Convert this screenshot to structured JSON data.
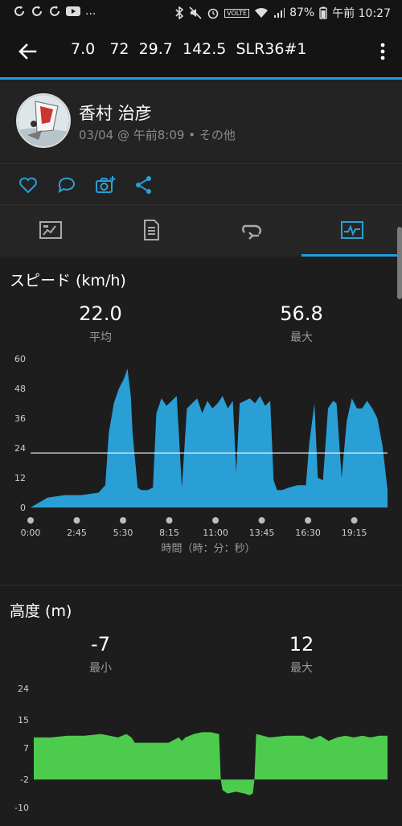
{
  "status_bar": {
    "notification_icons": [
      "sync-icon",
      "sync-icon",
      "sync-icon",
      "youtube-icon"
    ],
    "ellipsis": "...",
    "volte": "VOLTE",
    "battery": "87%",
    "time": "午前 10:27"
  },
  "app_bar": {
    "title": "7.0   72  29.7  142.5  SLR36#1"
  },
  "profile": {
    "name": "香村 治彦",
    "meta": "03/04 @ 午前8:09 • その他"
  },
  "speed": {
    "title": "スピード (km/h)",
    "avg_value": "22.0",
    "avg_label": "平均",
    "max_value": "56.8",
    "max_label": "最大",
    "x_title": "時間（時：分：秒）",
    "chart_data": {
      "type": "area",
      "title": "スピード (km/h)",
      "xlabel": "時間（時：分：秒）",
      "ylabel": "",
      "yticks": [
        "60",
        "48",
        "36",
        "24",
        "12",
        "0"
      ],
      "ylim": [
        0,
        60
      ],
      "xticks": [
        "0:00",
        "2:45",
        "5:30",
        "8:15",
        "11:00",
        "13:45",
        "16:30",
        "19:15"
      ],
      "xlim_minutes": [
        0,
        21.0
      ],
      "average_line": 22.0,
      "color": "#2a9fd6",
      "x_minutes": [
        0,
        1.0,
        2.0,
        3.0,
        4.0,
        4.4,
        4.6,
        4.9,
        5.2,
        5.5,
        5.7,
        5.9,
        6.0,
        6.3,
        6.5,
        6.9,
        7.2,
        7.4,
        7.7,
        8.0,
        8.3,
        8.6,
        8.9,
        9.2,
        9.5,
        9.8,
        10.1,
        10.4,
        10.7,
        11.0,
        11.3,
        11.6,
        11.9,
        12.1,
        12.3,
        12.6,
        12.9,
        13.2,
        13.5,
        13.8,
        14.1,
        14.3,
        14.5,
        14.8,
        15.2,
        15.7,
        16.2,
        16.4,
        16.7,
        16.9,
        17.2,
        17.5,
        17.8,
        18.0,
        18.3,
        18.6,
        18.9,
        19.2,
        19.5,
        19.8,
        20.1,
        20.4,
        20.7,
        21.0
      ],
      "y_values": [
        0,
        4,
        5,
        5,
        6,
        9,
        30,
        42,
        48,
        52,
        56,
        45,
        30,
        8,
        7,
        7,
        8,
        38,
        44,
        41,
        43,
        45,
        8,
        40,
        42,
        44,
        38,
        43,
        40,
        42,
        45,
        40,
        43,
        14,
        42,
        43,
        44,
        42,
        45,
        41,
        43,
        11,
        7,
        7,
        8,
        9,
        9,
        26,
        42,
        12,
        11,
        40,
        43,
        42,
        12,
        35,
        44,
        40,
        40,
        43,
        40,
        36,
        25,
        7
      ]
    }
  },
  "altitude": {
    "title": "高度 (m)",
    "min_value": "-7",
    "min_label": "最小",
    "max_value": "12",
    "max_label": "最大",
    "chart_data": {
      "type": "area",
      "title": "高度 (m)",
      "yticks": [
        "24",
        "15",
        "7",
        "-2",
        "-10"
      ],
      "ylim": [
        -10,
        24
      ],
      "baseline": -2,
      "color": "#4ccb4c",
      "x_minutes": [
        0,
        1.0,
        2.0,
        3.0,
        4.0,
        5.0,
        5.5,
        5.8,
        6.0,
        7.0,
        8.0,
        8.6,
        8.8,
        9.0,
        9.5,
        10.0,
        10.5,
        11.0,
        11.1,
        11.2,
        11.5,
        12.0,
        12.5,
        12.8,
        13.0,
        13.1,
        13.2,
        14.0,
        15.0,
        16.0,
        16.5,
        17.0,
        17.5,
        18.0,
        18.5,
        19.0,
        19.5,
        20.0,
        20.5,
        21.0
      ],
      "y_values": [
        10,
        10,
        10.5,
        10.5,
        11,
        10,
        11,
        10,
        8.5,
        8.5,
        8.5,
        10,
        9,
        10,
        11,
        11.5,
        11.5,
        11,
        -2,
        -5,
        -6,
        -5.5,
        -6,
        -6.5,
        -6,
        -2,
        11,
        10,
        10.5,
        10.5,
        9.5,
        10.5,
        9,
        10,
        10.5,
        10,
        10.5,
        10,
        10.5,
        10.5
      ]
    }
  }
}
